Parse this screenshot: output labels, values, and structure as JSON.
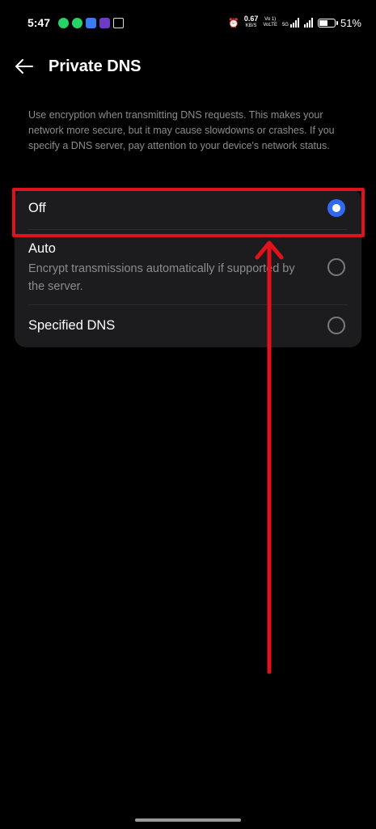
{
  "status_bar": {
    "time": "5:47",
    "notifications": [
      "whatsapp-icon",
      "whatsapp-business-icon",
      "bag-icon",
      "phonepe-icon",
      "window-icon"
    ],
    "net_speed": "0.67",
    "net_unit": "KB/S",
    "volte1": "Vo 1)",
    "volte2": "VoLTE",
    "network_gen": "5G",
    "battery_percent": "51%",
    "battery_level": 0.51
  },
  "header": {
    "back_icon": "back-arrow-icon",
    "title": "Private DNS"
  },
  "description": "Use encryption when transmitting DNS requests. This makes your network more secure, but it may cause slowdowns or crashes. If you specify a DNS server, pay attention to your device's network status.",
  "options": [
    {
      "title": "Off",
      "subtitle": "",
      "selected": true
    },
    {
      "title": "Auto",
      "subtitle": "Encrypt transmissions automatically if supported by the server.",
      "selected": false
    },
    {
      "title": "Specified DNS",
      "subtitle": "",
      "selected": false
    }
  ],
  "colors": {
    "background": "#000000",
    "card": "#1c1c1e",
    "accent": "#2f6bf2",
    "annotation_red": "#e0121b",
    "secondary_text": "#8c8c8c"
  }
}
